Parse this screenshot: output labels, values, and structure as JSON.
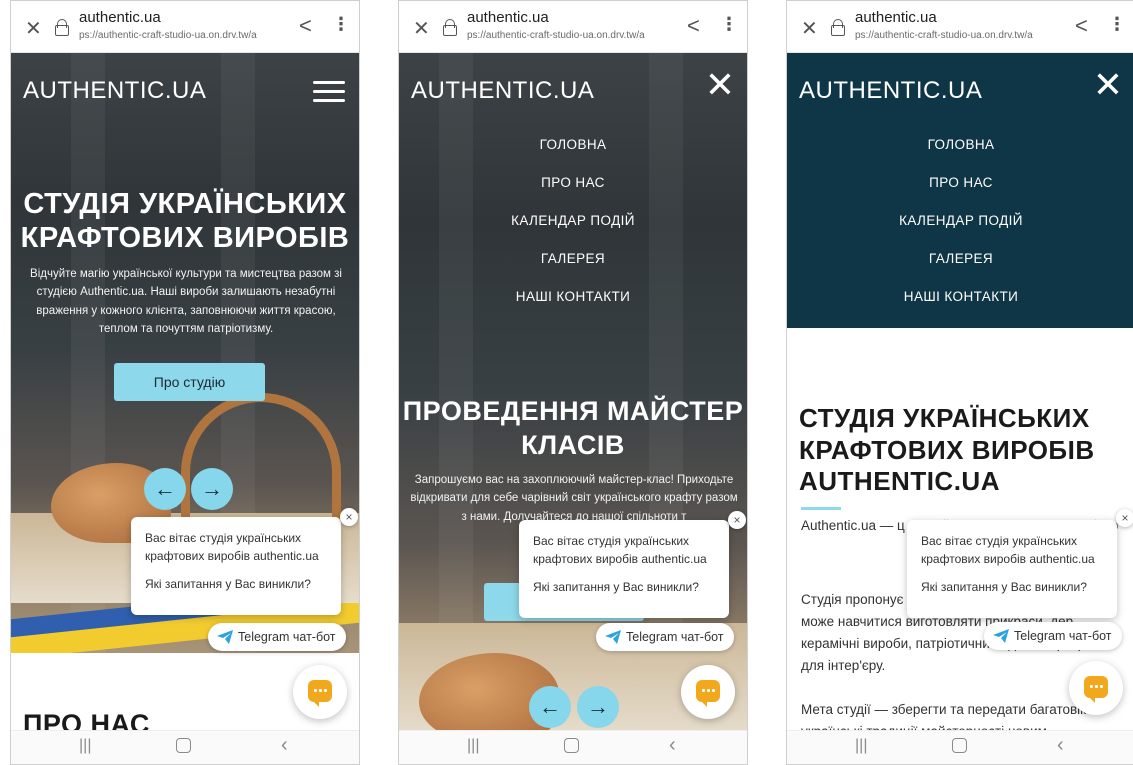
{
  "browser": {
    "domain": "authentic.ua",
    "url": "ps://authentic-craft-studio-ua.on.drv.tw/a"
  },
  "site": {
    "logo": "AUTHENTIC.UA"
  },
  "menu": {
    "items": [
      "ГОЛОВНА",
      "ПРО НАС",
      "КАЛЕНДАР ПОДІЙ",
      "ГАЛЕРЕЯ",
      "НАШІ КОНТАКТИ"
    ]
  },
  "screen1": {
    "title": "СТУДІЯ УКРАЇНСЬКИХ КРАФТОВИХ ВИРОБІВ",
    "text": "Відчуйте магію української культури та мистецтва разом зі студією Authentic.ua. Наші вироби залишають незабутні враження у кожного клієнта, заповнюючи життя красою, теплом та почуттям патріотизму.",
    "button": "Про студію",
    "next_heading": "ПРО НАС"
  },
  "screen2": {
    "title": "ПРОВЕДЕННЯ МАЙСТЕР КЛАСІВ",
    "text": "Запрошуємо вас на захоплюючий майстер-клас! Приходьте відкривати для себе чарівний світ українського крафту разом з нами. Долучайтеся до нашої спільноти т"
  },
  "screen3": {
    "title": "СТУДІЯ УКРАЇНСЬКИХ КРАФТОВИХ ВИРОБІВ AUTHENTIC.UA",
    "p1": "Authentic.ua — ц виробів, яка спе популяризації тр",
    "p2": "Студія пропонує для дітей та дорослих, де кожен може навчитися виготовляти прикраси, дер керамічні вироби, патріотичний одяг та прикраси для інтер'єру.",
    "p3": "Мета студії — зберегти та передати багатовікові українські традиції майстерності новим"
  },
  "chat": {
    "greeting": "Вас вітає студія українських крафтових виробів authentic.ua",
    "question": "Які запитання у Вас виникли?",
    "close": "×",
    "telegram": "Telegram чат-бот"
  },
  "arrows": {
    "prev": "←",
    "next": "→"
  },
  "icons": {
    "close_tab": "close-icon",
    "lock": "lock-icon",
    "share": "share-icon",
    "more": "more-vert-icon",
    "menu": "hamburger-icon",
    "close_menu": "close-icon",
    "telegram": "telegram-icon",
    "chat": "chat-icon"
  },
  "colors": {
    "accent": "#8dd8ea",
    "menu_panel": "#0f3646",
    "chat_fab": "#f2a81d",
    "telegram": "#2aa3e0"
  }
}
